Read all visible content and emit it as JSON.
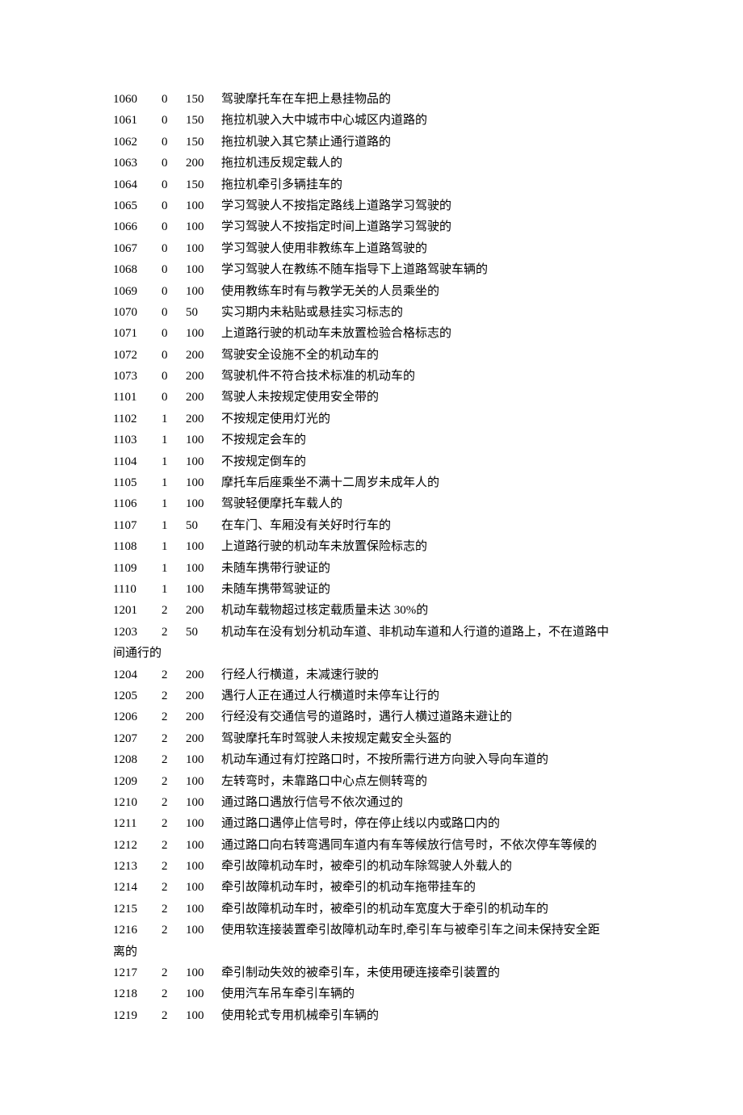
{
  "rows": [
    {
      "code": "1060",
      "pts": "0",
      "fine": "150",
      "desc": "驾驶摩托车在车把上悬挂物品的"
    },
    {
      "code": "1061",
      "pts": "0",
      "fine": "150",
      "desc": "拖拉机驶入大中城市中心城区内道路的"
    },
    {
      "code": "1062",
      "pts": "0",
      "fine": "150",
      "desc": "拖拉机驶入其它禁止通行道路的"
    },
    {
      "code": "1063",
      "pts": "0",
      "fine": "200",
      "desc": "拖拉机违反规定载人的"
    },
    {
      "code": "1064",
      "pts": "0",
      "fine": "150",
      "desc": "拖拉机牵引多辆挂车的"
    },
    {
      "code": "1065",
      "pts": "0",
      "fine": "100",
      "desc": "学习驾驶人不按指定路线上道路学习驾驶的"
    },
    {
      "code": "1066",
      "pts": "0",
      "fine": "100",
      "desc": "学习驾驶人不按指定时间上道路学习驾驶的"
    },
    {
      "code": "1067",
      "pts": "0",
      "fine": "100",
      "desc": "学习驾驶人使用非教练车上道路驾驶的"
    },
    {
      "code": "1068",
      "pts": "0",
      "fine": "100",
      "desc": "学习驾驶人在教练不随车指导下上道路驾驶车辆的"
    },
    {
      "code": "1069",
      "pts": "0",
      "fine": "100",
      "desc": "使用教练车时有与教学无关的人员乘坐的"
    },
    {
      "code": "1070",
      "pts": "0",
      "fine": "50",
      "desc": "实习期内未粘贴或悬挂实习标志的"
    },
    {
      "code": "1071",
      "pts": "0",
      "fine": "100",
      "desc": "上道路行驶的机动车未放置检验合格标志的"
    },
    {
      "code": "1072",
      "pts": "0",
      "fine": "200",
      "desc": "驾驶安全设施不全的机动车的"
    },
    {
      "code": "1073",
      "pts": "0",
      "fine": "200",
      "desc": "驾驶机件不符合技术标准的机动车的"
    },
    {
      "code": "1101",
      "pts": "0",
      "fine": "200",
      "desc": "驾驶人未按规定使用安全带的"
    },
    {
      "code": "1102",
      "pts": "1",
      "fine": "200",
      "desc": "不按规定使用灯光的"
    },
    {
      "code": "1103",
      "pts": "1",
      "fine": "100",
      "desc": "不按规定会车的"
    },
    {
      "code": "1104",
      "pts": "1",
      "fine": "100",
      "desc": "不按规定倒车的"
    },
    {
      "code": "1105",
      "pts": "1",
      "fine": "100",
      "desc": "摩托车后座乘坐不满十二周岁未成年人的"
    },
    {
      "code": "1106",
      "pts": "1",
      "fine": "100",
      "desc": "驾驶轻便摩托车载人的"
    },
    {
      "code": "1107",
      "pts": "1",
      "fine": "50",
      "desc": "在车门、车厢没有关好时行车的"
    },
    {
      "code": "1108",
      "pts": "1",
      "fine": "100",
      "desc": "上道路行驶的机动车未放置保险标志的"
    },
    {
      "code": "1109",
      "pts": "1",
      "fine": "100",
      "desc": "未随车携带行驶证的"
    },
    {
      "code": "1110",
      "pts": "1",
      "fine": "100",
      "desc": "未随车携带驾驶证的"
    },
    {
      "code": "1201",
      "pts": "2",
      "fine": "200",
      "desc": "机动车载物超过核定载质量未达 30%的"
    },
    {
      "code": "1203",
      "pts": "2",
      "fine": "50",
      "desc": "机动车在没有划分机动车道、非机动车道和人行道的道路上，不在道路中",
      "overflow": "间通行的"
    },
    {
      "code": "1204",
      "pts": "2",
      "fine": "200",
      "desc": "行经人行横道，未减速行驶的"
    },
    {
      "code": "1205",
      "pts": "2",
      "fine": "200",
      "desc": "遇行人正在通过人行横道时未停车让行的"
    },
    {
      "code": "1206",
      "pts": "2",
      "fine": "200",
      "desc": "行经没有交通信号的道路时，遇行人横过道路未避让的"
    },
    {
      "code": "1207",
      "pts": "2",
      "fine": "200",
      "desc": "驾驶摩托车时驾驶人未按规定戴安全头盔的"
    },
    {
      "code": "1208",
      "pts": "2",
      "fine": "100",
      "desc": "机动车通过有灯控路口时，不按所需行进方向驶入导向车道的"
    },
    {
      "code": "1209",
      "pts": "2",
      "fine": "100",
      "desc": "左转弯时，未靠路口中心点左侧转弯的"
    },
    {
      "code": "1210",
      "pts": "2",
      "fine": "100",
      "desc": "通过路口遇放行信号不依次通过的"
    },
    {
      "code": "1211",
      "pts": "2",
      "fine": "100",
      "desc": "通过路口遇停止信号时，停在停止线以内或路口内的"
    },
    {
      "code": "1212",
      "pts": "2",
      "fine": "100",
      "desc": "通过路口向右转弯遇同车道内有车等候放行信号时，不依次停车等候的"
    },
    {
      "code": "1213",
      "pts": "2",
      "fine": "100",
      "desc": "牵引故障机动车时，被牵引的机动车除驾驶人外载人的"
    },
    {
      "code": "1214",
      "pts": "2",
      "fine": "100",
      "desc": "牵引故障机动车时，被牵引的机动车拖带挂车的"
    },
    {
      "code": "1215",
      "pts": "2",
      "fine": "100",
      "desc": "牵引故障机动车时，被牵引的机动车宽度大于牵引的机动车的"
    },
    {
      "code": "1216",
      "pts": "2",
      "fine": "100",
      "desc": "使用软连接装置牵引故障机动车时,牵引车与被牵引车之间未保持安全距",
      "overflow": "离的"
    },
    {
      "code": "1217",
      "pts": "2",
      "fine": "100",
      "desc": "牵引制动失效的被牵引车，未使用硬连接牵引装置的"
    },
    {
      "code": "1218",
      "pts": "2",
      "fine": "100",
      "desc": "使用汽车吊车牵引车辆的"
    },
    {
      "code": "1219",
      "pts": "2",
      "fine": "100",
      "desc": "使用轮式专用机械牵引车辆的"
    }
  ]
}
